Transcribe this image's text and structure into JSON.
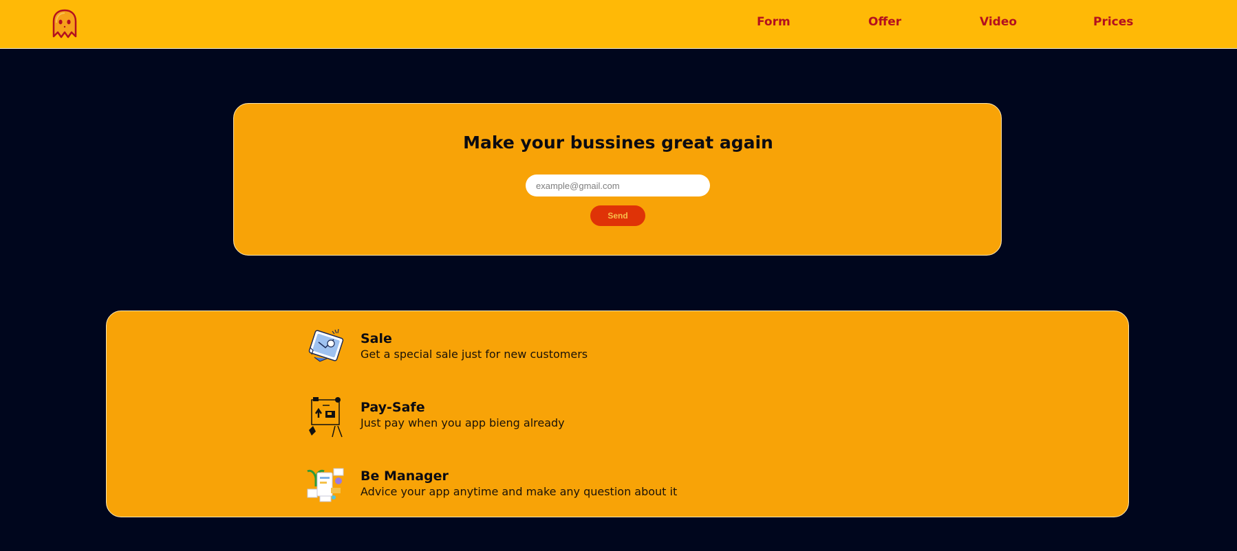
{
  "nav": {
    "links": [
      "Form",
      "Offer",
      "Video",
      "Prices"
    ]
  },
  "hero": {
    "title": "Make your bussines great again",
    "email_placeholder": "example@gmail.com",
    "send_label": "Send"
  },
  "features": [
    {
      "title": "Sale",
      "description": "Get a special sale just for new customers",
      "icon": "sale-illustration-icon"
    },
    {
      "title": "Pay-Safe",
      "description": "Just pay when you app bieng already",
      "icon": "pay-safe-illustration-icon"
    },
    {
      "title": "Be Manager",
      "description": "Advice your app anytime and make any question about it",
      "icon": "manager-illustration-icon"
    }
  ],
  "colors": {
    "page_background": "#00061d",
    "navbar": "#ffb906",
    "panel": "#f8a307",
    "nav_link": "#b3101f",
    "send_button": "#df3307",
    "send_text": "#f8c04a"
  }
}
